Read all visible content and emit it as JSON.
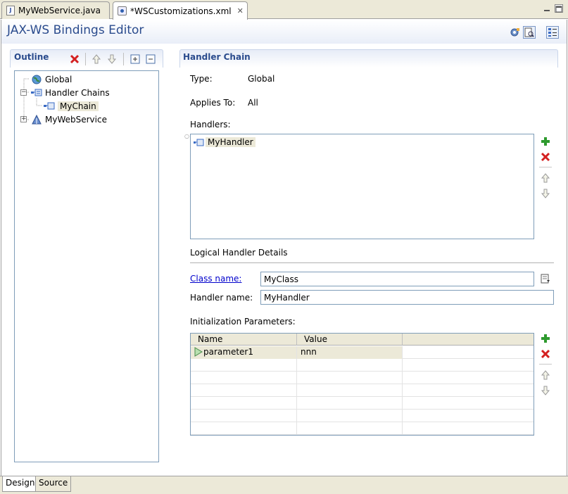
{
  "tabs": [
    {
      "label": "MyWebService.java",
      "icon": "java-file-icon",
      "active": false
    },
    {
      "label": "*WSCustomizations.xml",
      "icon": "xml-file-icon",
      "active": true
    }
  ],
  "editor": {
    "title": "JAX-WS Bindings Editor"
  },
  "outline": {
    "title": "Outline",
    "tree": [
      {
        "label": "Global",
        "icon": "globe-icon"
      },
      {
        "label": "Handler Chains",
        "icon": "handler-chains-icon"
      },
      {
        "label": "MyChain",
        "icon": "chain-icon"
      },
      {
        "label": "MyWebService",
        "icon": "web-service-icon"
      }
    ]
  },
  "handler_chain": {
    "title": "Handler Chain",
    "type_label": "Type:",
    "type_value": "Global",
    "applies_label": "Applies To:",
    "applies_value": "All",
    "handlers_label": "Handlers:",
    "handlers": [
      "MyHandler"
    ],
    "details_label": "Logical Handler Details",
    "class_name_label": "Class name:",
    "class_name_value": "MyClass",
    "handler_name_label": "Handler name:",
    "handler_name_value": "MyHandler",
    "init_params_label": "Initialization Parameters:",
    "columns": [
      "Name",
      "Value"
    ],
    "params": [
      {
        "name": "parameter1",
        "value": "nnn"
      }
    ]
  },
  "bottom_tabs": [
    {
      "label": "Design",
      "active": true
    },
    {
      "label": "Source",
      "active": false
    }
  ],
  "colors": {
    "accent": "#2a4b8d",
    "add": "#2e9a2e",
    "delete": "#d42020",
    "selection": "#ece9d8"
  }
}
